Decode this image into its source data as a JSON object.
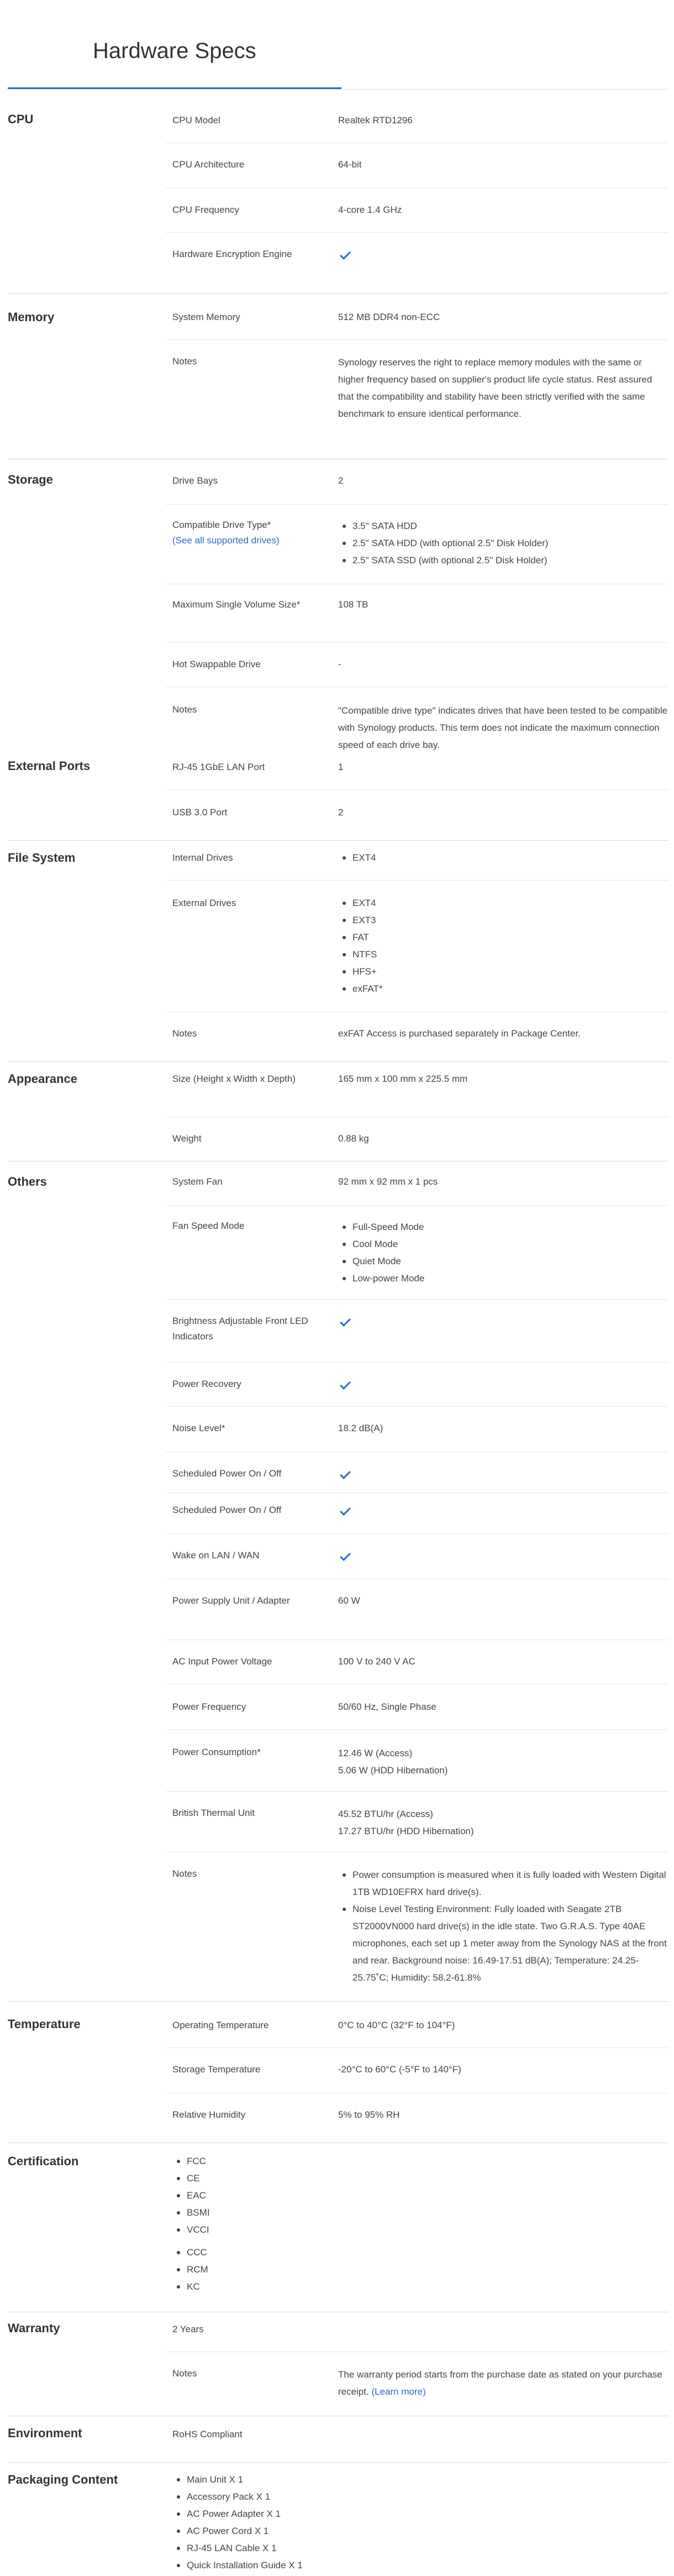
{
  "page": {
    "title": "Hardware Specs"
  },
  "accent_color": "#2a6bc4",
  "check_icon": "check-icon",
  "sections": {
    "cpu": {
      "title": "CPU",
      "rows": {
        "model": {
          "label": "CPU Model",
          "value": "Realtek RTD1296"
        },
        "arch": {
          "label": "CPU Architecture",
          "value": "64-bit"
        },
        "freq": {
          "label": "CPU Frequency",
          "value": "4-core 1.4 GHz"
        },
        "enc": {
          "label": "Hardware Encryption Engine",
          "value": true
        }
      }
    },
    "memory": {
      "title": "Memory",
      "rows": {
        "sys": {
          "label": "System Memory",
          "value": "512 MB DDR4 non-ECC"
        },
        "notes": {
          "label": "Notes",
          "value": "Synology reserves the right to replace memory modules with the same or higher frequency based on supplier's product life cycle status. Rest assured that the compatibility and stability have been strictly verified with the same benchmark to ensure identical performance."
        }
      }
    },
    "storage": {
      "title": "Storage",
      "rows": {
        "bays": {
          "label": "Drive Bays",
          "value": "2"
        },
        "types": {
          "label": "Compatible Drive Type*",
          "link": "(See all supported drives)",
          "items": [
            "3.5\" SATA HDD",
            "2.5\" SATA HDD (with optional 2.5\" Disk Holder)",
            "2.5\" SATA SSD (with optional 2.5\" Disk Holder)"
          ]
        },
        "maxvol": {
          "label": "Maximum Single Volume Size*",
          "value": "108 TB"
        },
        "hot": {
          "label": "Hot Swappable Drive",
          "value": "-"
        },
        "notes": {
          "label": "Notes",
          "value": "\"Compatible drive type\" indicates drives that have been tested to be compatible with Synology products. This term does not indicate the maximum connection speed of each drive bay."
        }
      }
    },
    "ports": {
      "title": "External Ports",
      "rows": {
        "lan": {
          "label": "RJ-45 1GbE LAN Port",
          "value": "1"
        },
        "usb": {
          "label": "USB 3.0 Port",
          "value": "2"
        }
      }
    },
    "fs": {
      "title": "File System",
      "rows": {
        "internal": {
          "label": "Internal Drives",
          "items": [
            "EXT4"
          ]
        },
        "external": {
          "label": "External Drives",
          "items": [
            "EXT4",
            "EXT3",
            "FAT",
            "NTFS",
            "HFS+",
            "exFAT*"
          ]
        },
        "notes": {
          "label": "Notes",
          "value": "exFAT Access is purchased separately in Package Center."
        }
      }
    },
    "appearance": {
      "title": "Appearance",
      "rows": {
        "size": {
          "label": "Size (Height x Width x Depth)",
          "value": "165 mm x 100 mm x 225.5 mm"
        },
        "weight": {
          "label": "Weight",
          "value": "0.88 kg"
        }
      }
    },
    "others": {
      "title": "Others",
      "rows": {
        "fan": {
          "label": "System Fan",
          "value": "92 mm x 92 mm x 1 pcs"
        },
        "fanmode": {
          "label": "Fan Speed Mode",
          "items": [
            "Full-Speed Mode",
            "Cool Mode",
            "Quiet Mode",
            "Low-power Mode"
          ]
        },
        "led": {
          "label": "Brightness Adjustable Front LED Indicators",
          "value": true
        },
        "recovery": {
          "label": "Power Recovery",
          "value": true
        },
        "noise": {
          "label": "Noise Level*",
          "value": "18.2 dB(A)"
        },
        "sched1": {
          "label": "Scheduled Power On / Off",
          "value": true
        },
        "sched2": {
          "label": "Scheduled Power On / Off",
          "value": true
        },
        "wol": {
          "label": "Wake on LAN / WAN",
          "value": true
        },
        "psu": {
          "label": "Power Supply Unit / Adapter",
          "value": "60 W"
        },
        "acv": {
          "label": "AC Input Power Voltage",
          "value": "100 V to 240 V AC"
        },
        "pfreq": {
          "label": "Power Frequency",
          "value": "50/60 Hz, Single Phase"
        },
        "pcons": {
          "label": "Power Consumption*",
          "line1": "12.46 W (Access)",
          "line2": "5.06 W (HDD Hibernation)"
        },
        "btu": {
          "label": "British Thermal Unit",
          "line1": "45.52 BTU/hr (Access)",
          "line2": "17.27 BTU/hr (HDD Hibernation)"
        },
        "notes": {
          "label": "Notes",
          "items": [
            "Power consumption is measured when it is fully loaded with Western Digital 1TB WD10EFRX hard drive(s).",
            "Noise Level Testing Environment: Fully loaded with Seagate 2TB ST2000VN000 hard drive(s) in the idle state. Two G.R.A.S. Type 40AE microphones, each set up 1 meter away from the Synology NAS at the front and rear. Background noise: 16.49-17.51 dB(A); Temperature: 24.25-25.75˚C; Humidity: 58.2-61.8%"
          ]
        }
      }
    },
    "temperature": {
      "title": "Temperature",
      "rows": {
        "op": {
          "label": "Operating Temperature",
          "value": "0°C to 40°C (32°F to 104°F)"
        },
        "st": {
          "label": "Storage Temperature",
          "value": "-20°C to 60°C (-5°F to 140°F)"
        },
        "rh": {
          "label": "Relative Humidity",
          "value": "5% to 95% RH"
        }
      }
    },
    "cert": {
      "title": "Certification",
      "items": [
        "FCC",
        "CE",
        "EAC",
        "BSMI",
        "VCCI",
        "CCC",
        "RCM",
        "KC"
      ]
    },
    "warranty": {
      "title": "Warranty",
      "value": "2 Years",
      "notes": {
        "label": "Notes",
        "value": "The warranty period starts from the purchase date as stated on your purchase receipt.",
        "link": "(Learn more)"
      }
    },
    "env": {
      "title": "Environment",
      "value": "RoHS Compliant"
    },
    "pkg": {
      "title": "Packaging Content",
      "items": [
        "Main Unit X 1",
        "Accessory Pack X 1",
        "AC Power Adapter X 1",
        "AC Power Cord X 1",
        "RJ-45 LAN Cable X 1",
        "Quick Installation Guide X 1"
      ]
    }
  }
}
